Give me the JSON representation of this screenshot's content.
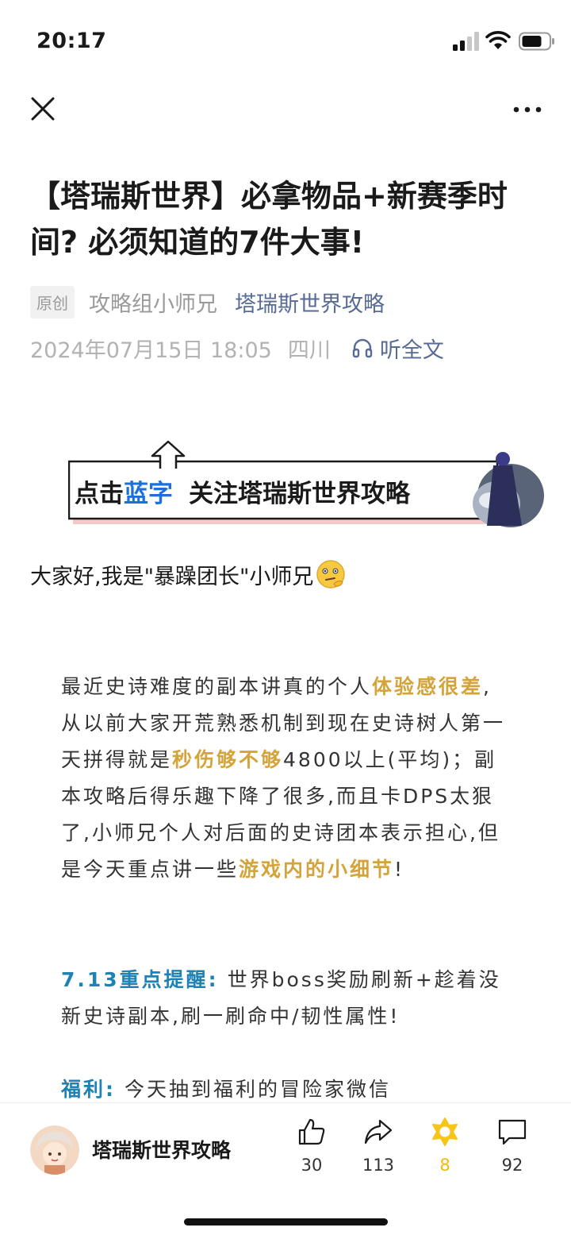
{
  "status_bar": {
    "time": "20:17",
    "signal_icon": "cellular-signal-icon",
    "wifi_icon": "wifi-icon",
    "battery_icon": "battery-icon"
  },
  "nav": {
    "close_icon": "close-icon",
    "more_icon": "more-dots-icon"
  },
  "article": {
    "title": "【塔瑞斯世界】必拿物品+新赛季时间? 必须知道的7件大事!",
    "original_tag": "原创",
    "author": "攻略组小师兄",
    "account": "塔瑞斯世界攻略",
    "datetime": "2024年07月15日 18:05",
    "location": "四川",
    "listen_label": "听全文",
    "banner": {
      "prefix": "点击",
      "blue_word": "蓝字",
      "suffix": "关注塔瑞斯世界攻略"
    },
    "greeting": "大家好,我是\"暴躁团长\"小师兄",
    "para1": {
      "t1": "最近史诗难度的副本讲真的个人",
      "h1": "体验感很差",
      "t2": ",从以前大家开荒熟悉机制到现在史诗树人第一天拼得就是",
      "h2": "秒伤够不够",
      "t3": "4800以上(平均)；副本攻略后得乐趣下降了很多,而且卡DPS太狠了,小师兄个人对后面的史诗团本表示担心,但是今天重点讲一些",
      "h3": "游戏内的小细节",
      "t4": "!"
    },
    "para2": {
      "label": "7.13重点提醒:",
      "text": " 世界boss奖励刷新+趁着没新史诗副本,刷一刷命中/韧性属性!"
    },
    "para3": {
      "label": "福利:",
      "text": " 今天抽到福利的冒险家微信"
    }
  },
  "bottom_bar": {
    "account_name": "塔瑞斯世界攻略",
    "like_count": "30",
    "share_count": "113",
    "star_count": "8",
    "comment_count": "92"
  },
  "colors": {
    "link": "#576b95",
    "gold": "#d4a43b",
    "teal": "#1e82b4",
    "star": "#f5c518"
  }
}
